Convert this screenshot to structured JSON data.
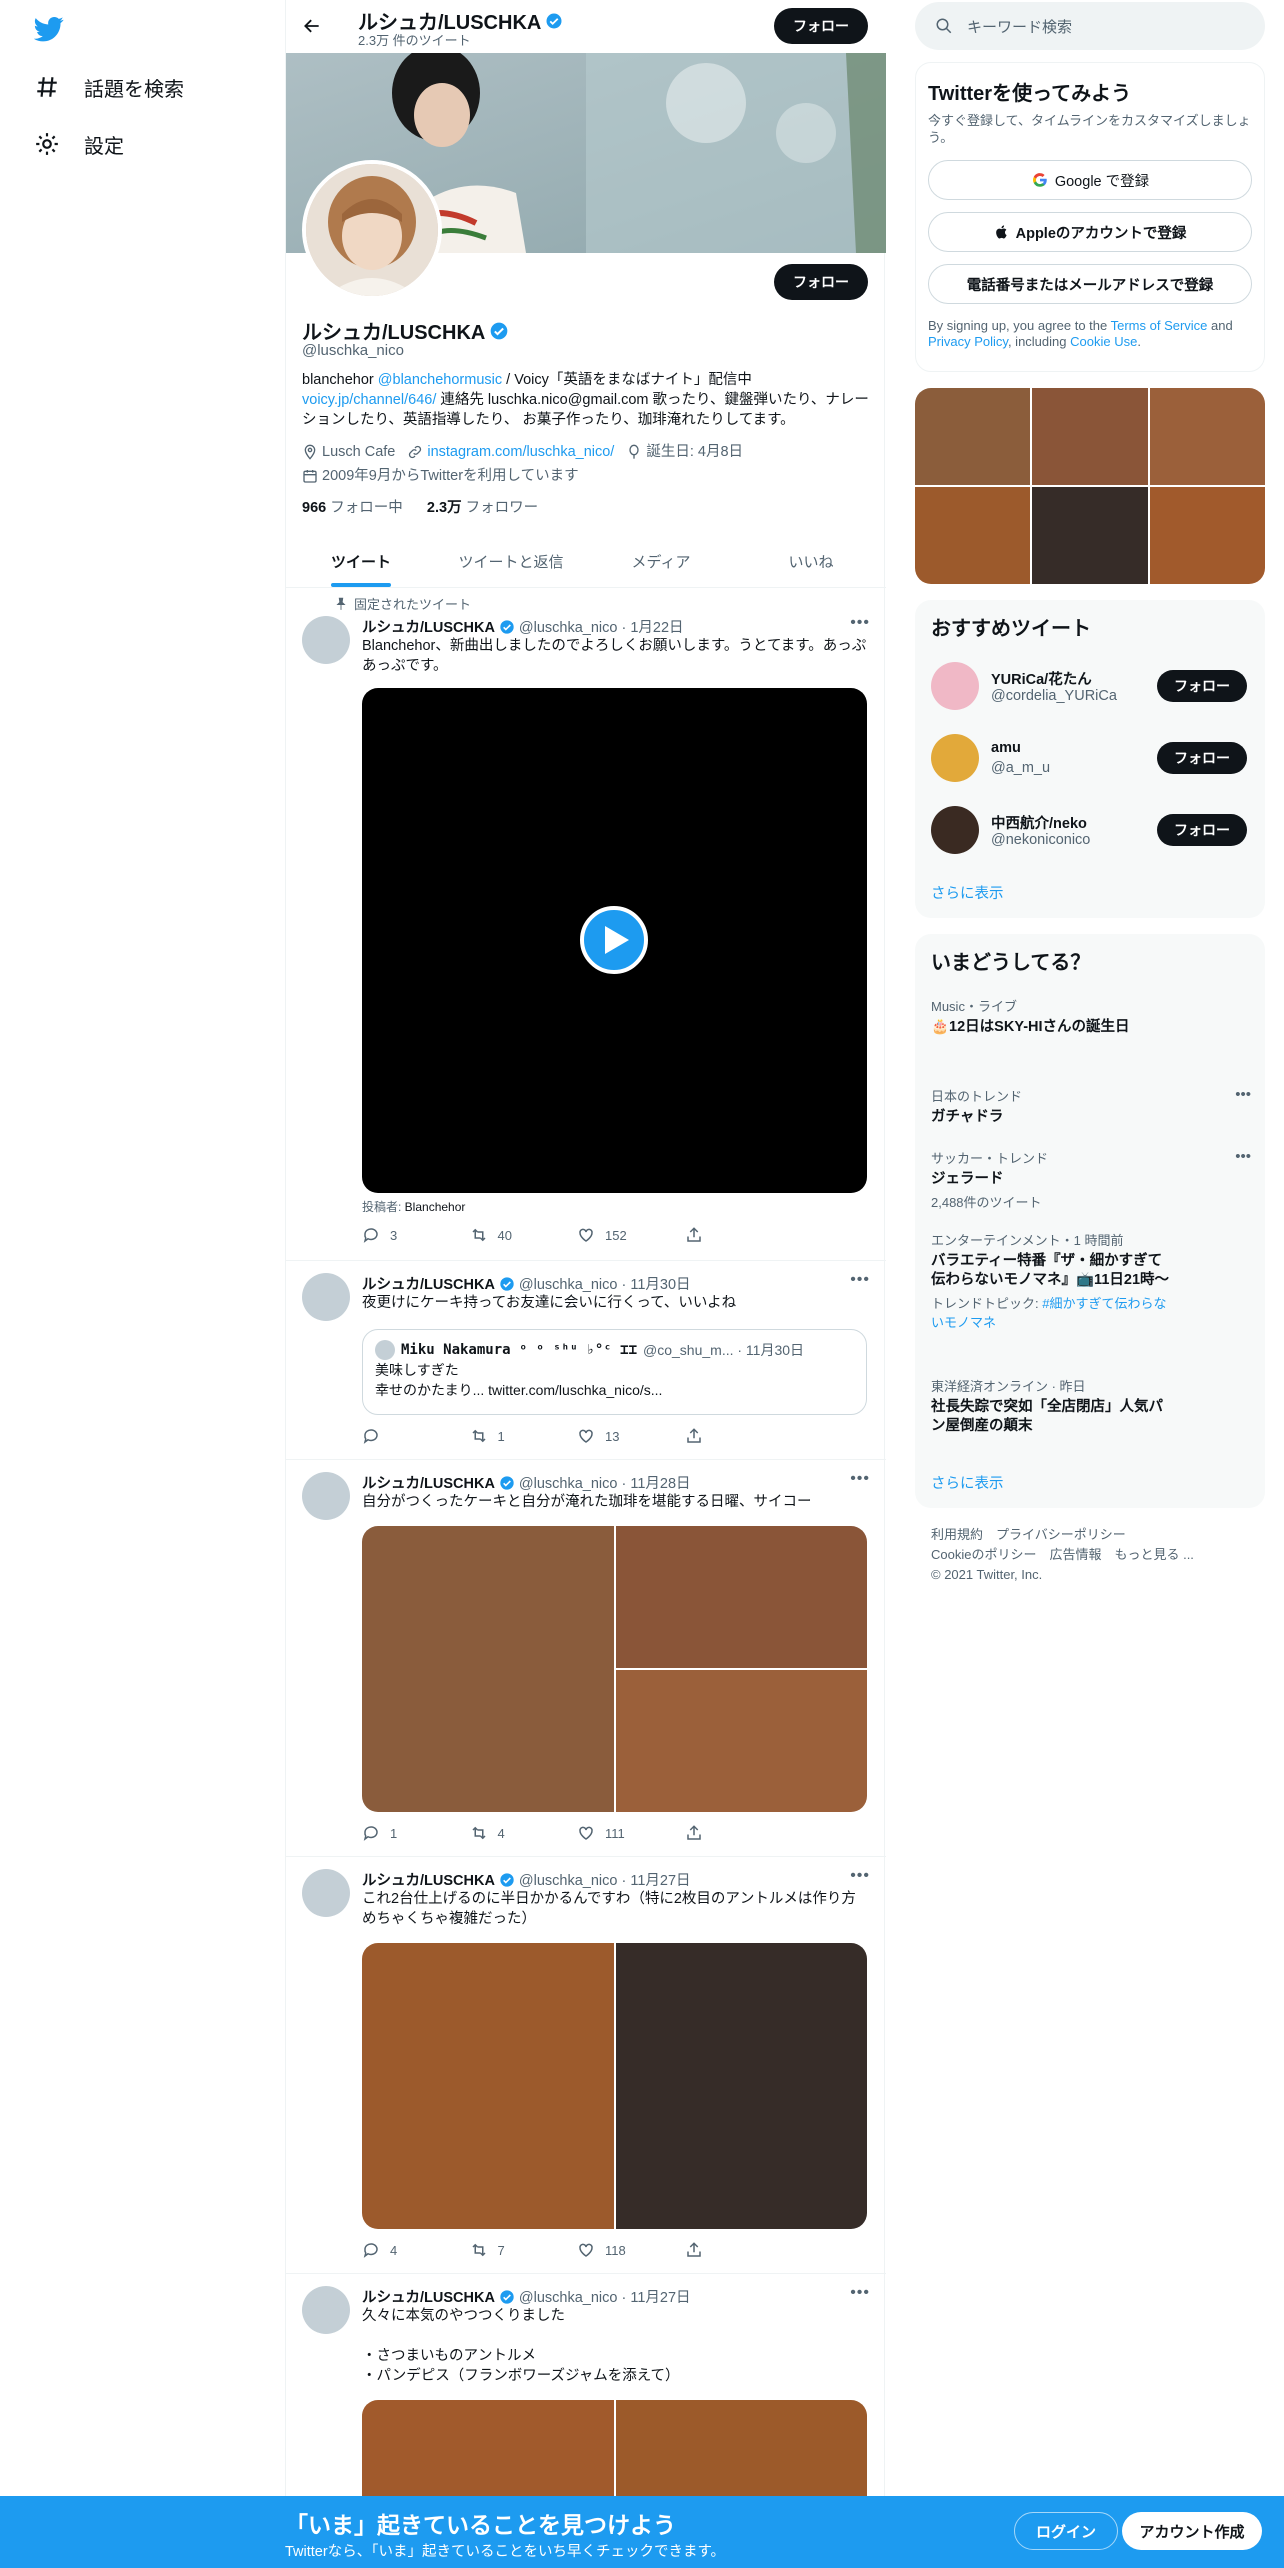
{
  "nav": {
    "explore": "話題を検索",
    "settings": "設定"
  },
  "header": {
    "name": "ルシュカ/LUSCHKA",
    "tweet_count": "2.3万 件のツイート",
    "follow": "フォロー"
  },
  "profile": {
    "name": "ルシュカ/LUSCHKA",
    "handle": "@luschka_nico",
    "follow": "フォロー",
    "bio_1": "blanchehor ",
    "bio_link1": "@blanchehormusic",
    "bio_2": " / Voicy「英語をまなばナイト」配信中",
    "bio_link2": "voicy.jp/channel/646/",
    "bio_3": " 連絡先 luschka.nico@gmail.com 歌ったり、鍵盤弾いたり、ナレーションしたり、英語指導したり、 お菓子作ったり、珈琲淹れたりしてます。",
    "location": "Lusch Cafe",
    "url": "instagram.com/luschka_nico/",
    "birthday": "誕生日: 4月8日",
    "joined": "2009年9月からTwitterを利用しています",
    "following_count": "966",
    "following_label": " フォロー中",
    "followers_count": "2.3万",
    "followers_label": " フォロワー"
  },
  "tabs": [
    "ツイート",
    "ツイートと返信",
    "メディア",
    "いいね"
  ],
  "pinned_label": "固定されたツイート",
  "tweets": [
    {
      "name": "ルシュカ/LUSCHKA",
      "meta": "@luschka_nico · 1月22日",
      "text": "Blanchehor、新曲出しましたのでよろしくお願いします。うとてます。あっぷあっぷです。",
      "poster": "投稿者: ",
      "poster_name": "Blanchehor",
      "reply": "3",
      "retweet": "40",
      "like": "152"
    },
    {
      "name": "ルシュカ/LUSCHKA",
      "meta": "@luschka_nico · 11月30日",
      "text": "夜更けにケーキ持ってお友達に会いに行くって、いいよね",
      "quote_name": "Miku Nakamura ᵒ ᵒ ˢʰᵘ ♭°ᶜ ⌶⌶",
      "quote_meta": "@co_shu_m... · 11月30日",
      "quote_text": "美味しすぎた\n幸せのかたまり... twitter.com/luschka_nico/s...",
      "reply": "",
      "retweet": "1",
      "like": "13"
    },
    {
      "name": "ルシュカ/LUSCHKA",
      "meta": "@luschka_nico · 11月28日",
      "text": "自分がつくったケーキと自分が淹れた珈琲を堪能する日曜、サイコー",
      "reply": "1",
      "retweet": "4",
      "like": "111"
    },
    {
      "name": "ルシュカ/LUSCHKA",
      "meta": "@luschka_nico · 11月27日",
      "text": "これ2台仕上げるのに半日かかるんですわ（特に2枚目のアントルメは作り方めちゃくちゃ複雑だった）",
      "reply": "4",
      "retweet": "7",
      "like": "118"
    },
    {
      "name": "ルシュカ/LUSCHKA",
      "meta": "@luschka_nico · 11月27日",
      "text": "久々に本気のやつつくりました\n\n・さつまいものアントルメ\n・パンデピス（フランボワーズジャムを添えて）"
    }
  ],
  "right": {
    "search_placeholder": "キーワード検索",
    "signup_title": "Twitterを使ってみよう",
    "signup_sub": "今すぐ登録して、タイムラインをカスタマイズしましょう。",
    "google": "Google で登録",
    "apple": "Appleのアカウントで登録",
    "phone": "電話番号またはメールアドレスで登録",
    "tos_1": "By signing up, you agree to the ",
    "tos_link1": "Terms of Service",
    "tos_2": " and ",
    "tos_link2": "Privacy Policy",
    "tos_3": ", including ",
    "tos_link3": "Cookie Use",
    "tos_4": ".",
    "recommend_title": "おすすめツイート",
    "suggestions": [
      {
        "name": "YURiCa/花たん",
        "handle": "@cordelia_YURiCa",
        "follow": "フォロー"
      },
      {
        "name": "amu",
        "handle": "@a_m_u",
        "follow": "フォロー"
      },
      {
        "name": "中西航介/neko",
        "handle": "@nekoniconico",
        "follow": "フォロー"
      }
    ],
    "show_more": "さらに表示",
    "trends_title": "いまどうしてる？",
    "trends": [
      {
        "meta": "Music・ライブ",
        "title": "🎂12日はSKY-HIさんの誕生日"
      },
      {
        "meta": "日本のトレンド",
        "title": "ガチャドラ"
      },
      {
        "meta": "サッカー・トレンド",
        "title": "ジェラード",
        "count": "2,488件のツイート"
      },
      {
        "meta": "エンターテインメント・1 時間前",
        "title": "バラエティー特番『ザ・細かすぎて伝わらないモノマネ』📺11日21時〜",
        "topic": "トレンドトピック: ",
        "topic_link": "#細かすぎて伝わらないモノマネ"
      },
      {
        "meta": "東洋経済オンライン · 昨日",
        "title": "社長失踪で突如「全店閉店」人気パン屋倒産の顛末"
      }
    ],
    "trends_more": "さらに表示",
    "footer_1": "利用規約　プライバシーポリシー",
    "footer_2": "Cookieのポリシー　広告情報　もっと見る ...",
    "footer_3": "© 2021 Twitter, Inc."
  },
  "bottom": {
    "title": "「いま」起きていることを見つけよう",
    "sub": "Twitterなら、「いま」起きていることをいち早くチェックできます。",
    "login": "ログイン",
    "signup": "アカウント作成"
  },
  "colors": {
    "accent": "#1d9bf0",
    "text": "#0f1419",
    "muted": "#536471"
  }
}
